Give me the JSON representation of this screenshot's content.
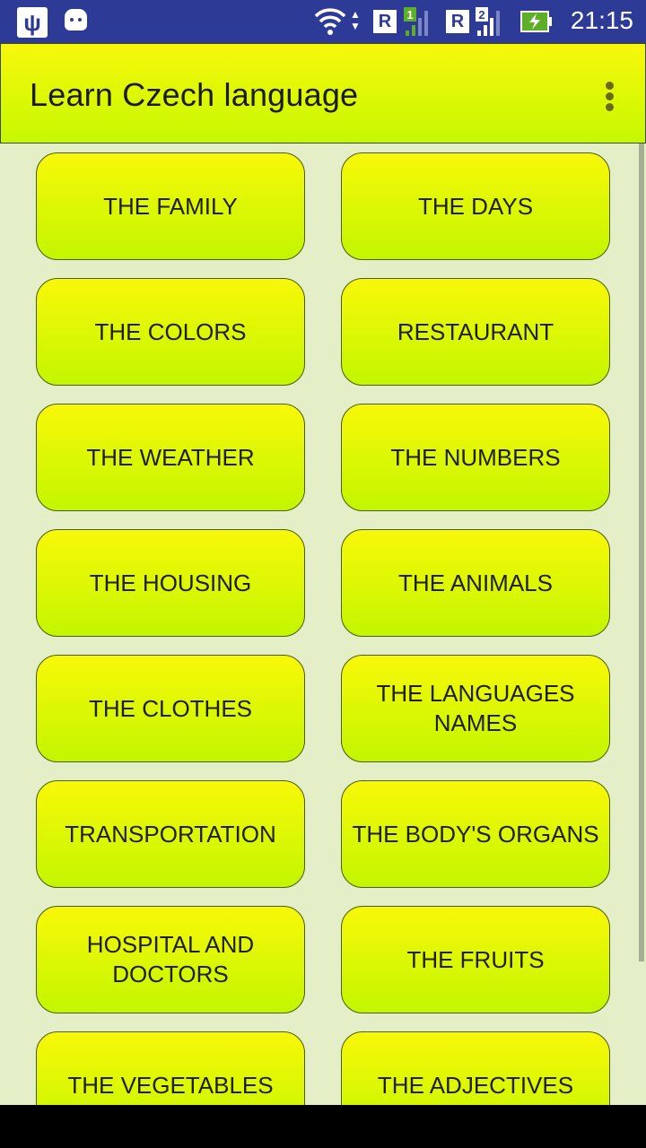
{
  "status_bar": {
    "time": "21:15",
    "icons": [
      "usb-icon",
      "android-debug-icon",
      "wifi-icon",
      "data-activity-icon",
      "roaming-r-icon",
      "signal-sim1-icon",
      "roaming-r-icon",
      "signal-sim2-icon",
      "battery-charging-icon"
    ],
    "sim1_label": "1",
    "sim2_label": "2",
    "roaming_label": "R",
    "usb_glyph": "ψ",
    "updown_glyph": "▲▼",
    "colors": {
      "background": "#2e3b96",
      "sim1_badge": "#5fae2a",
      "battery": "#5fae2a"
    }
  },
  "app_bar": {
    "title": "Learn Czech language",
    "overflow_menu_icon": "more-vertical-icon",
    "colors": {
      "gradient_top": "#f7f80a",
      "gradient_bottom": "#c6f800"
    }
  },
  "main": {
    "background": "#e4efc8",
    "categories": [
      {
        "label": "THE FAMILY"
      },
      {
        "label": "THE DAYS"
      },
      {
        "label": "THE COLORS"
      },
      {
        "label": "RESTAURANT"
      },
      {
        "label": "THE WEATHER"
      },
      {
        "label": "THE NUMBERS"
      },
      {
        "label": "THE HOUSING"
      },
      {
        "label": "THE ANIMALS"
      },
      {
        "label": "THE CLOTHES"
      },
      {
        "label": "THE LANGUAGES NAMES"
      },
      {
        "label": "TRANSPORTATION"
      },
      {
        "label": "THE BODY'S ORGANS"
      },
      {
        "label": "HOSPITAL AND DOCTORS"
      },
      {
        "label": "THE FRUITS"
      },
      {
        "label": "THE VEGETABLES"
      },
      {
        "label": "THE ADJECTIVES"
      }
    ]
  }
}
